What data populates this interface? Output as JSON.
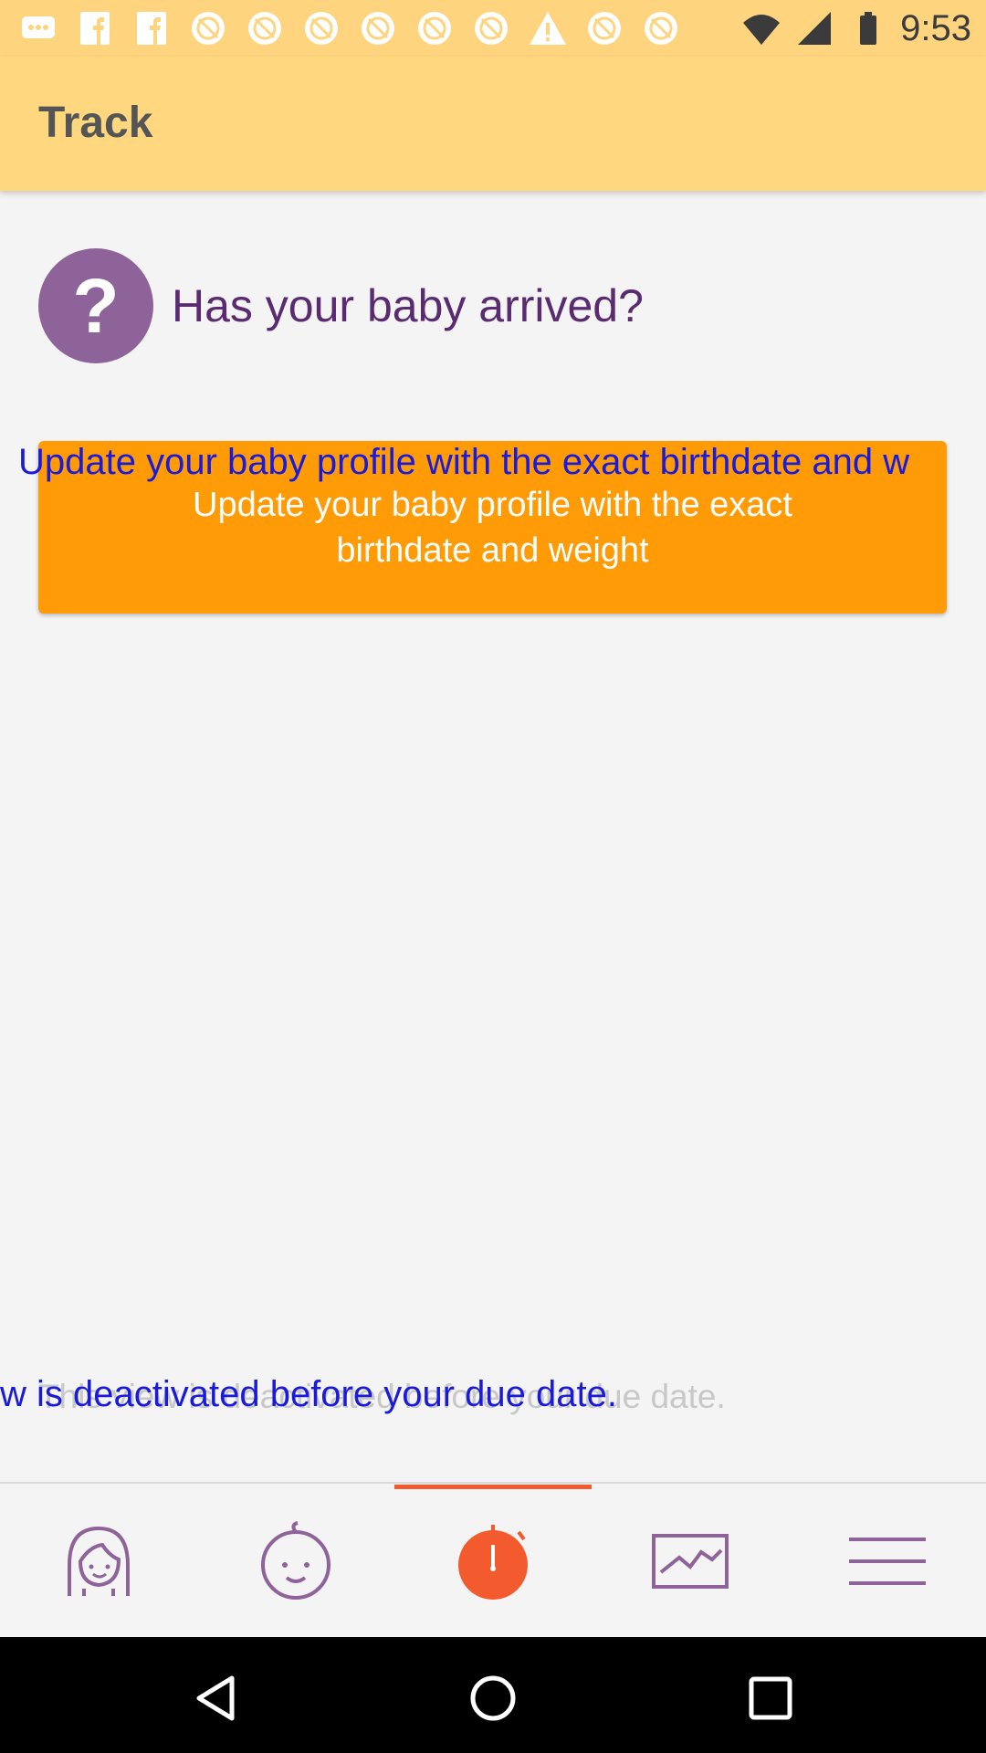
{
  "status_bar": {
    "time": "9:53",
    "icons": [
      "chat-icon",
      "facebook-icon",
      "facebook-icon",
      "no-sync-icon",
      "no-sync-icon",
      "no-sync-icon",
      "no-sync-icon",
      "no-sync-icon",
      "no-sync-icon",
      "warning-icon",
      "no-sync-icon",
      "no-sync-icon",
      "wifi-icon",
      "signal-icon",
      "battery-icon"
    ]
  },
  "app_bar": {
    "title": "Track"
  },
  "question": {
    "icon": "question-icon",
    "text": "Has your baby arrived?"
  },
  "update_button": {
    "label": "Update your baby profile with the exact birthdate and weight",
    "overlay_text": "Update your baby profile with the exact birthdate and w"
  },
  "deactivated_message": {
    "text": "This view is deactivated before your due date.",
    "overlay_text": "w is deactivated before your due date."
  },
  "tabs": [
    {
      "name": "mother-tab",
      "icon": "mother-icon"
    },
    {
      "name": "baby-tab",
      "icon": "baby-icon"
    },
    {
      "name": "track-tab",
      "icon": "timer-icon",
      "active": true
    },
    {
      "name": "charts-tab",
      "icon": "chart-icon"
    },
    {
      "name": "menu-tab",
      "icon": "menu-icon"
    }
  ],
  "colors": {
    "app_bar": "#ffd77f",
    "accent_orange": "#ff9b06",
    "active_tab": "#f35b2f",
    "question_purple": "#8e6399",
    "question_text": "#5b2b72",
    "overlay_blue": "#1a1adb"
  }
}
